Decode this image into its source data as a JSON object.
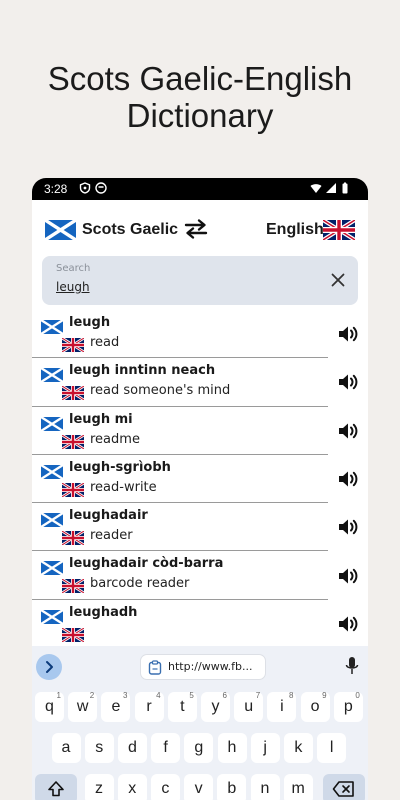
{
  "headline": {
    "line1": "Scots Gaelic-English",
    "line2": "Dictionary"
  },
  "status": {
    "time": "3:28"
  },
  "langbar": {
    "source": "Scots Gaelic",
    "target": "English",
    "swap_icon": "swap-arrows-icon"
  },
  "search": {
    "placeholder": "Search",
    "value": "leugh"
  },
  "results": [
    {
      "term": "leugh",
      "translation": "read"
    },
    {
      "term": "leugh inntinn neach",
      "translation": "read someone's mind"
    },
    {
      "term": "leugh mi",
      "translation": "readme"
    },
    {
      "term": "leugh-sgrìobh",
      "translation": "read-write"
    },
    {
      "term": "leughadair",
      "translation": "reader"
    },
    {
      "term": "leughadair còd-barra",
      "translation": "barcode reader"
    },
    {
      "term": "leughadh",
      "translation": ""
    }
  ],
  "keyboard": {
    "suggestion_url": "http://www.fb...",
    "row1": [
      {
        "k": "q",
        "s": "1"
      },
      {
        "k": "w",
        "s": "2"
      },
      {
        "k": "e",
        "s": "3"
      },
      {
        "k": "r",
        "s": "4"
      },
      {
        "k": "t",
        "s": "5"
      },
      {
        "k": "y",
        "s": "6"
      },
      {
        "k": "u",
        "s": "7"
      },
      {
        "k": "i",
        "s": "8"
      },
      {
        "k": "o",
        "s": "9"
      },
      {
        "k": "p",
        "s": "0"
      }
    ],
    "row2": [
      "a",
      "s",
      "d",
      "f",
      "g",
      "h",
      "j",
      "k",
      "l"
    ],
    "row3": [
      "z",
      "x",
      "c",
      "v",
      "b",
      "n",
      "m"
    ]
  },
  "colors": {
    "search_bg": "#dfe4ec",
    "keyboard_bg": "#eef1f7",
    "chevron_bg": "#a8c8ee",
    "saltire_blue": "#1565c0"
  }
}
